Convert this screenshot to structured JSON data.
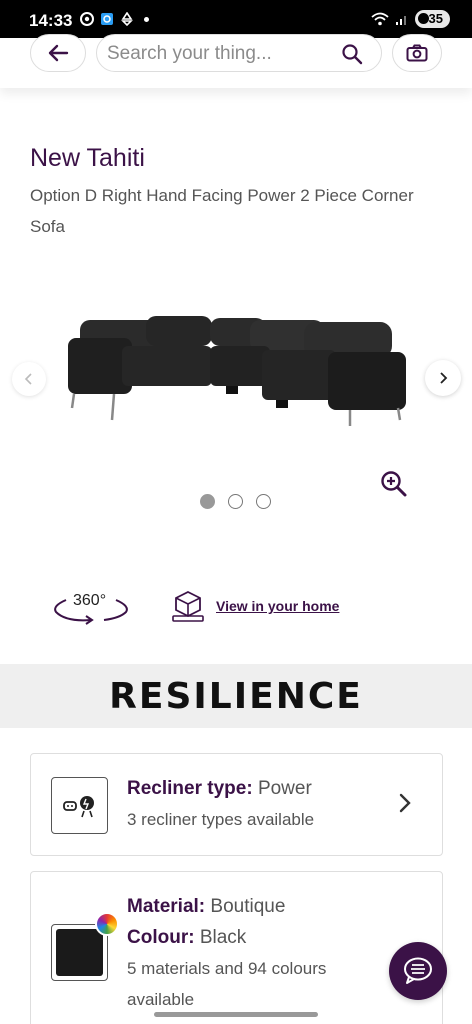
{
  "status": {
    "time": "14:33",
    "battery": "35"
  },
  "header": {
    "search_placeholder": "Search your thing..."
  },
  "product": {
    "name": "New Tahiti",
    "description": "Option D Right Hand Facing Power 2 Piece Corner Sofa"
  },
  "gallery": {
    "total_images": 3,
    "active_index": 0
  },
  "actions": {
    "rotate_label": "360°",
    "view_home_label": "View in your home"
  },
  "brand": {
    "name": "RESILIENCE"
  },
  "options": {
    "recliner": {
      "label": "Recliner type:",
      "value": "Power",
      "sub": "3 recliner types available"
    },
    "material": {
      "label": "Material:",
      "value": "Boutique"
    },
    "colour": {
      "label": "Colour:",
      "value": "Black",
      "swatch": "#1a1a1a"
    },
    "material_sub": "5 materials and 94 colours available"
  },
  "colors": {
    "brand_purple": "#3b1247"
  },
  "icons": {
    "back": "arrow-left-icon",
    "search": "search-icon",
    "camera": "camera-icon",
    "zoom": "zoom-in-icon",
    "chat": "chat-icon"
  }
}
